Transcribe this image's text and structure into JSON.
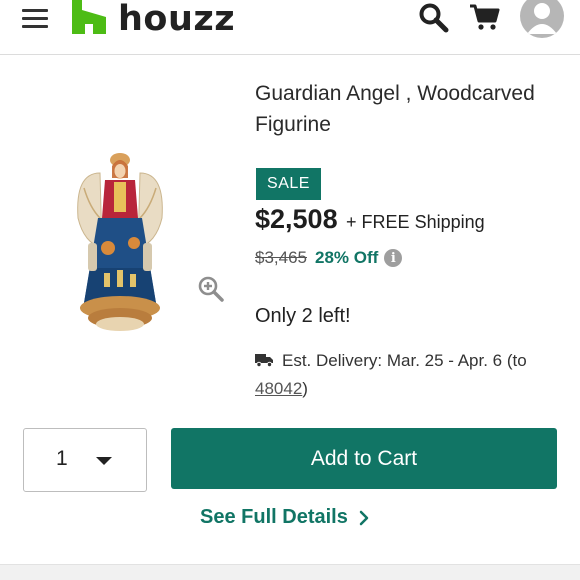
{
  "header": {
    "brand": "houzz",
    "icons": [
      "menu-icon",
      "search-icon",
      "cart-icon",
      "avatar-icon"
    ]
  },
  "product": {
    "title": "Guardian Angel , Woodcarved Figurine",
    "sale_badge": "SALE",
    "price": "$2,508",
    "shipping": "+ FREE Shipping",
    "original_price": "$3,465",
    "discount": "28% Off",
    "info_glyph": "i",
    "stock": "Only 2 left!",
    "delivery_text": "Est. Delivery: Mar. 25 - Apr. 6 (to ",
    "delivery_zip": "48042",
    "delivery_close": ")"
  },
  "purchase": {
    "quantity": "1",
    "add_to_cart": "Add to Cart",
    "see_full_details": "See Full Details"
  },
  "colors": {
    "brand_green": "#117565",
    "logo_green": "#4dbc15"
  }
}
